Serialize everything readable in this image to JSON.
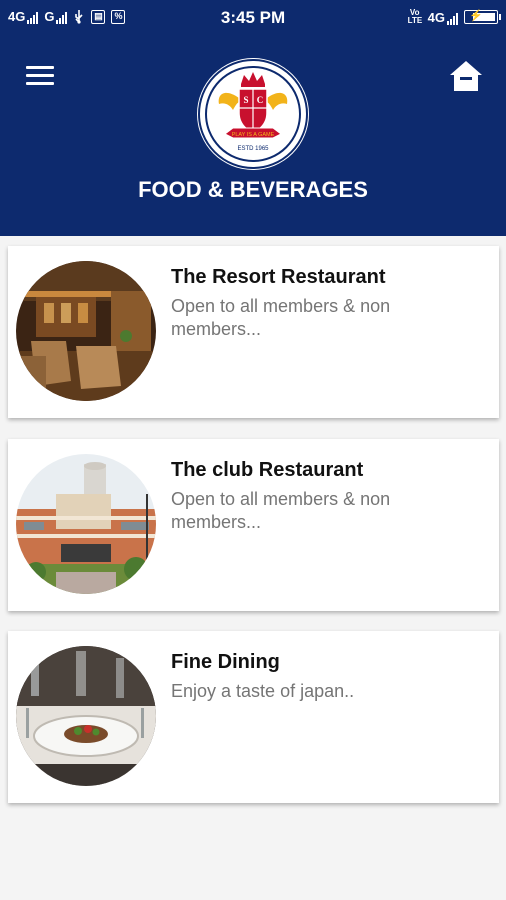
{
  "status_bar": {
    "net1": "4G",
    "net2": "G",
    "time": "3:45 PM",
    "volte": "Vo LTE",
    "net3": "4G"
  },
  "header": {
    "title": "FOOD & BEVERAGES",
    "logo_motto": "PLAY IS A GAME",
    "logo_estd": "ESTD 1965",
    "menu_icon": "menu-icon",
    "home_icon": "home-icon",
    "colors": {
      "brand": "#0d2a6e",
      "logo_red": "#c8102e",
      "logo_gold": "#f2b31a"
    }
  },
  "restaurants": [
    {
      "title": "The Resort Restaurant",
      "description": "Open to all members & non members..."
    },
    {
      "title": "The club Restaurant",
      "description": "Open to all members & non members..."
    },
    {
      "title": "Fine Dining",
      "description": "Enjoy a taste of japan.."
    }
  ]
}
